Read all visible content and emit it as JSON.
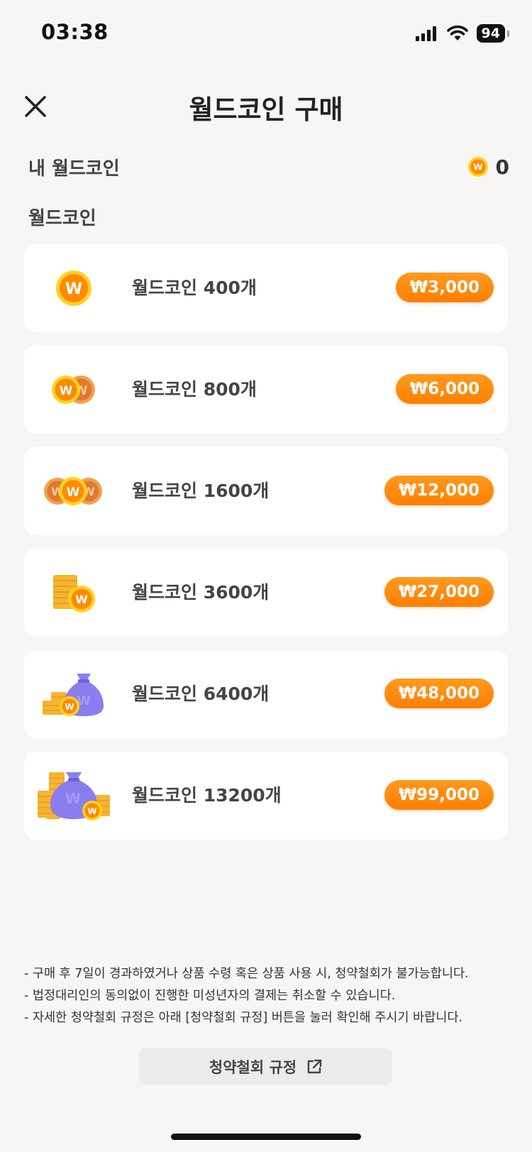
{
  "status_bar": {
    "time": "03:38",
    "battery": "94"
  },
  "header": {
    "title": "월드코인 구매"
  },
  "my_coin": {
    "label": "내 월드코인",
    "value": "0"
  },
  "section": {
    "label": "월드코인"
  },
  "products": [
    {
      "name": "월드코인 400개",
      "price": "₩3,000",
      "icon": "single-coin-icon"
    },
    {
      "name": "월드코인 800개",
      "price": "₩6,000",
      "icon": "two-coins-icon"
    },
    {
      "name": "월드코인 1600개",
      "price": "₩12,000",
      "icon": "three-coins-icon"
    },
    {
      "name": "월드코인 3600개",
      "price": "₩27,000",
      "icon": "coin-stack-icon"
    },
    {
      "name": "월드코인 6400개",
      "price": "₩48,000",
      "icon": "coin-bag-icon"
    },
    {
      "name": "월드코인 13200개",
      "price": "₩99,000",
      "icon": "large-coin-bag-icon"
    }
  ],
  "notice": [
    "- 구매 후 7일이 경과하였거나 상품 수령 혹은 상품 사용 시, 청약철회가 불가능합니다.",
    "- 법정대리인의 동의없이 진행한 미성년자의 결제는 취소할 수 있습니다.",
    "- 자세한 청약철회 규정은 아래 [청약철회 규정] 버튼을 눌러 확인해 주시기 바랍니다."
  ],
  "policy_button": {
    "label": "청약철회 규정"
  },
  "colors": {
    "accent": "#ff8a00",
    "coin": "#ff9a1f",
    "bag": "#8a7df0"
  }
}
